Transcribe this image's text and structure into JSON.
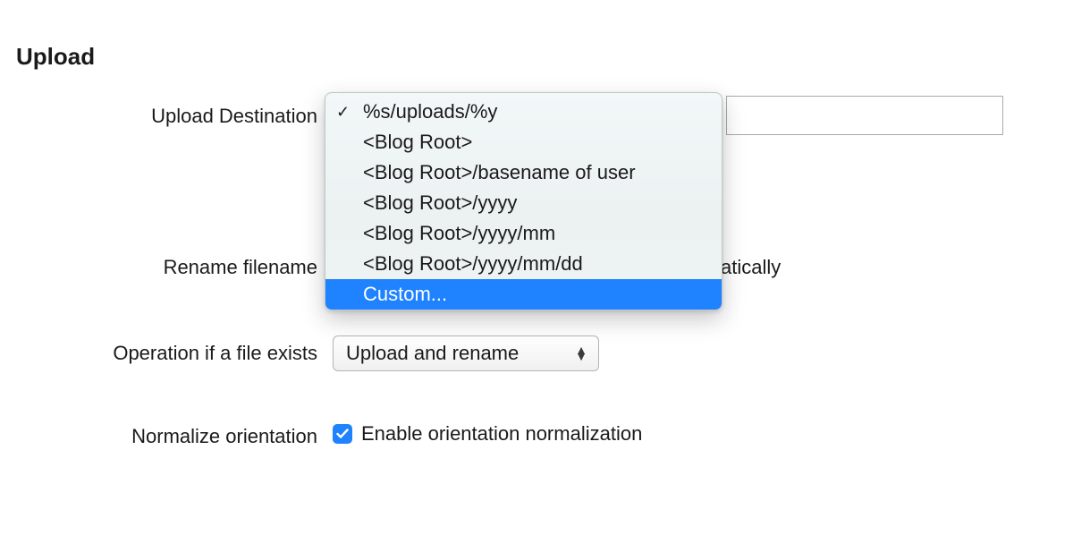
{
  "section_title": "Upload",
  "labels": {
    "upload_destination": "Upload Destination",
    "rename_filename": "Rename filename",
    "operation_exists": "Operation if a file exists",
    "normalize_orientation": "Normalize orientation"
  },
  "upload_destination": {
    "input_value": "",
    "dropdown": {
      "selected_index": 0,
      "highlighted_index": 6,
      "options": [
        "%s/uploads/%y",
        "<Blog Root>",
        "<Blog Root>/basename of user",
        "<Blog Root>/yyyy",
        "<Blog Root>/yyyy/mm",
        "<Blog Root>/yyyy/mm/dd",
        "Custom..."
      ]
    }
  },
  "rename": {
    "obscured_fragment": "atically"
  },
  "operation": {
    "selected": "Upload and rename"
  },
  "normalize": {
    "checked": true,
    "label": "Enable orientation normalization"
  }
}
